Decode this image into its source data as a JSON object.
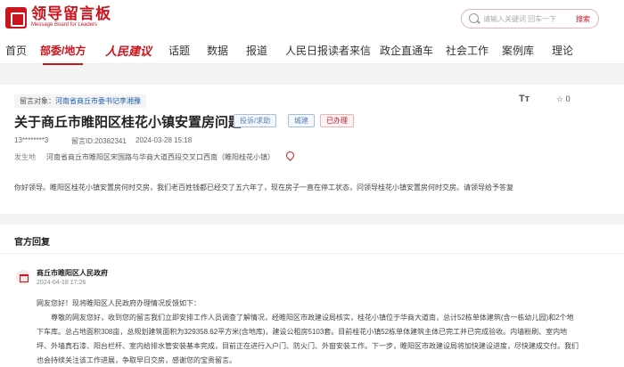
{
  "header": {
    "logo_cn": "领导留言板",
    "logo_en": "Message Board for Leaders",
    "search_placeholder": "请输入关键词 回车一下",
    "search_label": "搜索"
  },
  "nav": {
    "items": [
      "首页",
      "部委/地方",
      "人民建议",
      "话题",
      "数据",
      "报道",
      "人民日报读者来信",
      "政企直通车",
      "社会工作",
      "案例库",
      "理论"
    ]
  },
  "post": {
    "recipient_label": "留言对象：",
    "recipient_value": "河南省商丘市委书记李湘豫",
    "title": "关于商丘市睢阳区桂花小镇安置房问题",
    "tags": {
      "type": "投诉/求助",
      "field": "城建",
      "status": "已办理"
    },
    "font_icon": "Tт",
    "star_count": "0",
    "user": "13********3",
    "id_text": "留言ID:20382341",
    "time": "2024-03-28 15:18",
    "address_label": "发生地",
    "address": "河南省商丘市睢阳区宋国路与华商大道西段交叉口西南（睢阳桂花小镇）",
    "content": "你好领导。睢阳区桂花小镇安置房何时交房，我们老百姓钱都已经交了五六年了，现在房子一直在停工状态，问领导桂花小镇安置房何时交房。请领导给予答复"
  },
  "reply": {
    "heading": "官方回复",
    "org": "商丘市睢阳区人民政府",
    "date": "2024-04-18 17:26",
    "lines": [
      "网友您好！现将睢阳区人民政府办理情况反馈如下：",
      "尊敬的网友您好，收到您的留言我们立即安排工作人员调查了解情况，经睢阳区市政建设局核实，桂花小镇位于华商大道南，总计52栋单体建筑(含一栋幼儿园)和2个地",
      "下车库。总占地面积308亩，总规划建筑面积为329358.62平方米(含地库)，建设公租房5103套。目前桂花小镇52栋单体建筑主体已完工并已完成验收。内墙粉刷、室内地",
      "坪、外墙真石漆、阳台栏杆、室内给排水管安装基本完成，目前正在进行入户门、防火门、外窗安装工作。下一步，睢阳区市政建设局将加快建设进度，尽快建成交付。我们",
      "也会持续关注该工作进展，争取早日交房，感谢您的宝贵留言。"
    ]
  }
}
